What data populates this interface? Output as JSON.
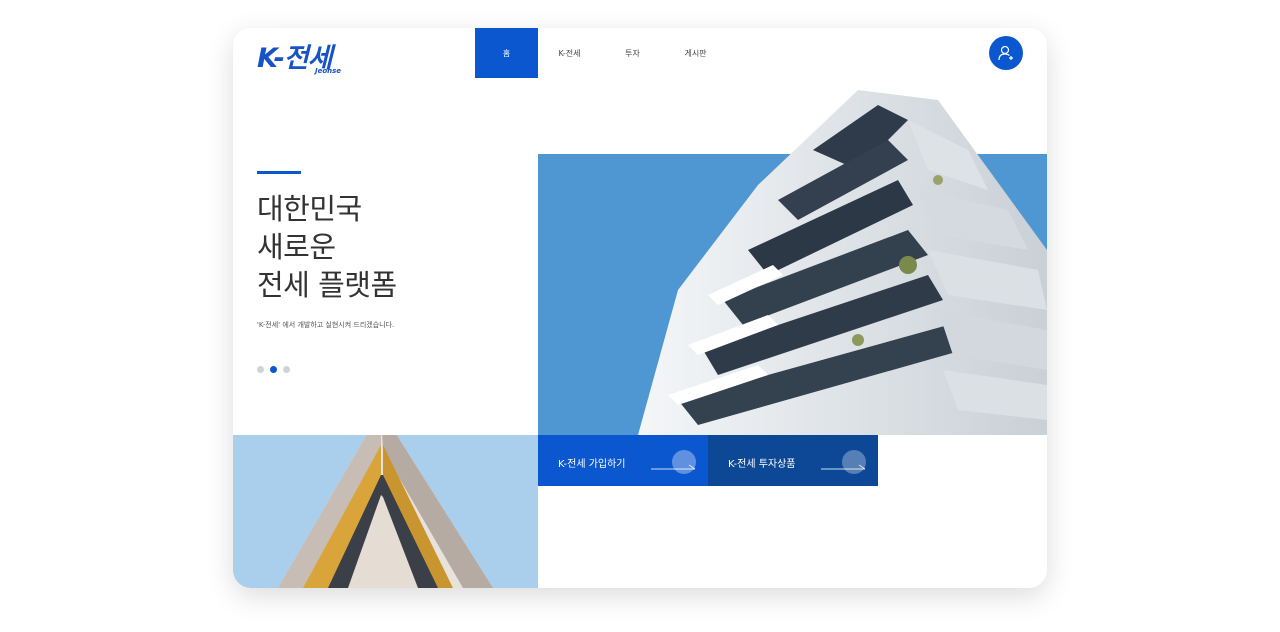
{
  "brand": {
    "logo_main": "K-전세",
    "logo_sub": "Jeonse"
  },
  "nav": {
    "items": [
      {
        "label": "홈",
        "active": true
      },
      {
        "label": "K-전세",
        "active": false
      },
      {
        "label": "투자",
        "active": false
      },
      {
        "label": "게시판",
        "active": false
      }
    ]
  },
  "header": {
    "user_icon": "user-add-icon"
  },
  "hero": {
    "headline_lines": [
      "대한민국",
      "새로운",
      "전세 플랫폼"
    ],
    "subtext": "'K-전세' 에서 개발하고 실현시켜 드리겠습니다.",
    "slides": {
      "count": 3,
      "active_index": 1
    }
  },
  "cta": [
    {
      "label": "K-전세 가입하기",
      "icon": "arrow-right-icon"
    },
    {
      "label": "K-전세 투자상품",
      "icon": "arrow-right-icon"
    }
  ],
  "colors": {
    "primary": "#0a57cf",
    "dark_blue": "#0c4896",
    "sky": "#4f97d2",
    "light_sky": "#a9cfed"
  }
}
